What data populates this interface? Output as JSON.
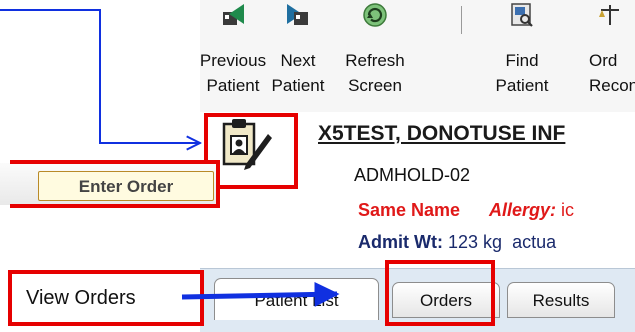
{
  "toolbar": {
    "buttons": [
      {
        "line1": "Previous",
        "line2": "Patient",
        "icon": "previous-patient-icon"
      },
      {
        "line1": "Next",
        "line2": "Patient",
        "icon": "next-patient-icon"
      },
      {
        "line1": "Refresh",
        "line2": "Screen",
        "icon": "refresh-icon"
      },
      {
        "line1": "Find",
        "line2": "Patient",
        "icon": "find-patient-icon"
      },
      {
        "line1": "Ord",
        "line2": "Reconc",
        "icon": "order-reconcile-icon"
      }
    ]
  },
  "patient": {
    "name": "X5TEST, DONOTUSE INF",
    "status": "ADMHOLD-02",
    "same_name": "Same Name",
    "allergy_label": "Allergy:",
    "allergy_value": "ic",
    "admit_label": "Admit Wt:",
    "admit_value": "123 kg",
    "actual_text": "actua"
  },
  "tooltip": {
    "text": "Enter Order"
  },
  "tabs": [
    {
      "label": "Patient List"
    },
    {
      "label": "Orders"
    },
    {
      "label": "Results"
    }
  ],
  "annotations": {
    "view_orders_label": "View Orders",
    "highlight_color": "#e60000",
    "arrow_color": "#1030e0"
  }
}
